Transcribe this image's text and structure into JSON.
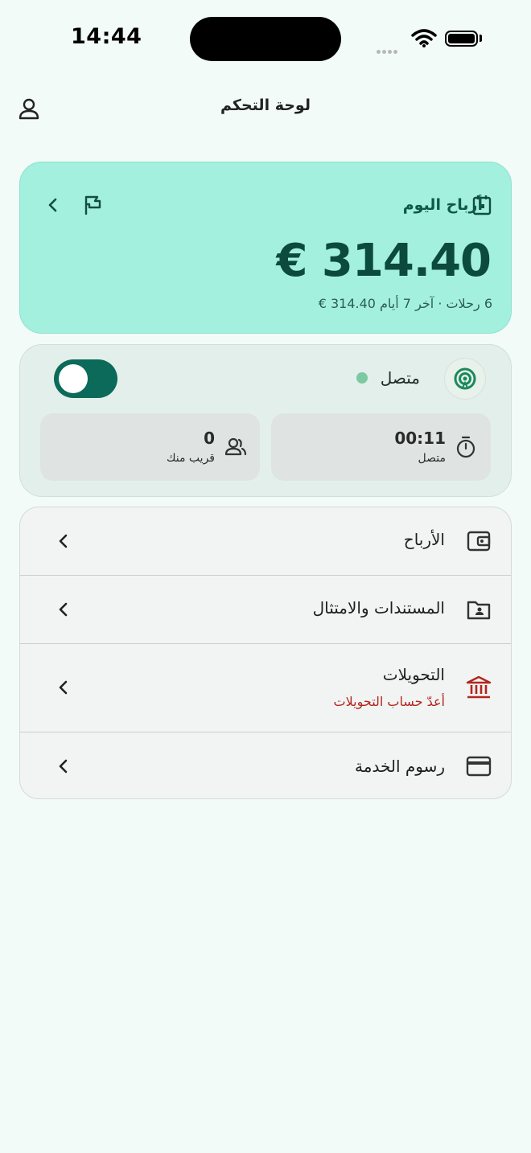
{
  "status_bar": {
    "time": "14:44"
  },
  "header": {
    "title": "لوحة التحكم"
  },
  "earnings_card": {
    "heading": "أرباح اليوم",
    "amount": "€ 314.40",
    "summary": "6 رحلات · آخر 7 أيام 314.40 €"
  },
  "status_card": {
    "online_label": "متصل",
    "toggle_on": true,
    "tiles": [
      {
        "value": "00:11",
        "label": "متصل",
        "icon": "stopwatch-icon"
      },
      {
        "value": "0",
        "label": "قريب منك",
        "icon": "users-icon"
      }
    ]
  },
  "menu": {
    "items": [
      {
        "label": "الأرباح",
        "icon": "wallet-icon"
      },
      {
        "label": "المستندات والامتثال",
        "icon": "folder-user-icon"
      },
      {
        "label": "التحويلات",
        "sublabel": "أعدّ حساب التحويلات",
        "icon": "bank-icon"
      },
      {
        "label": "رسوم الخدمة",
        "icon": "credit-card-icon"
      }
    ]
  },
  "colors": {
    "earnings_bg": "#a3f0df",
    "accent_dark": "#0b6a59",
    "warning_text": "#b3261e",
    "bank_icon": "#b3261e"
  }
}
